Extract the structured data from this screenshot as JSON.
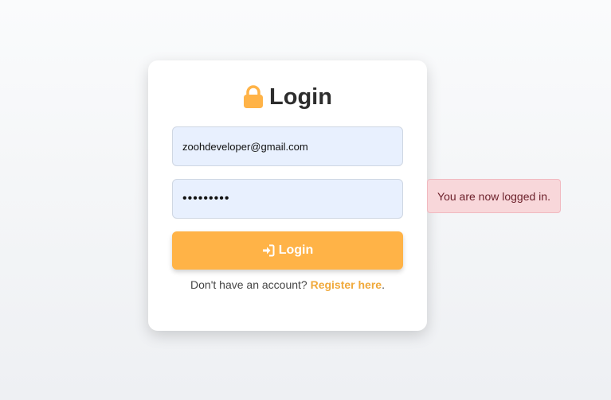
{
  "login_card": {
    "title": "Login",
    "lock_icon": "lock-icon",
    "lock_color": "#ffb347",
    "email_value": "zoohdeveloper@gmail.com",
    "password_value": "•••••••••",
    "login_button_label": "Login",
    "login_button_icon": "sign-in-icon",
    "button_color": "#ffb347",
    "register_prompt": "Don't have an account? ",
    "register_link": "Register here",
    "register_suffix": "."
  },
  "toast": {
    "message": "You are now logged in.",
    "background": "#f8d7da"
  }
}
